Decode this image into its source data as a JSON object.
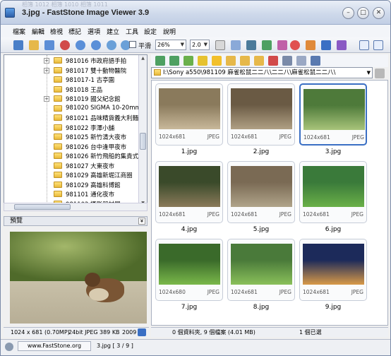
{
  "window": {
    "title": "3.jpg  -  FastStone Image Viewer 3.9",
    "ghost_tabs": "   相簿 1012    相簿 1010    相簿 1011"
  },
  "menu": [
    "檔案",
    "編輯",
    "檢視",
    "標記",
    "選項",
    "建立",
    "工具",
    "設定",
    "說明"
  ],
  "toolbar": {
    "zoom_value": "26%",
    "ratio_value": "2.0",
    "smooth_label": "平滑"
  },
  "tree": {
    "items": [
      {
        "label": "981016 市政府語手拍",
        "expandable": true
      },
      {
        "label": "981017 雙十動物醫院",
        "expandable": true
      },
      {
        "label": "981017-1 古亭園",
        "expandable": false
      },
      {
        "label": "981018 王品",
        "expandable": false
      },
      {
        "label": "981019 國父紀念館",
        "expandable": true
      },
      {
        "label": "981020 SIGMA 10-20mm",
        "expandable": false
      },
      {
        "label": "981021 品味精貨義大利麵",
        "expandable": false
      },
      {
        "label": "981022 李澤小舖",
        "expandable": false
      },
      {
        "label": "981025 新竹清大夜市",
        "expandable": false
      },
      {
        "label": "981026 台中逢甲夜市",
        "expandable": false
      },
      {
        "label": "981026 新竹飛船的集貴式",
        "expandable": false
      },
      {
        "label": "981027 大東夜市",
        "expandable": false
      },
      {
        "label": "981029 高雄新堀江商圈",
        "expandable": false
      },
      {
        "label": "981029 高雄科博館",
        "expandable": false
      },
      {
        "label": "981101 通化夜市",
        "expandable": false
      },
      {
        "label": "981102 攝影器材展",
        "expandable": false
      }
    ]
  },
  "preview": {
    "header": "預覽"
  },
  "status_left": {
    "dims": "1024 x 681 (0.70MP)",
    "fmt": "24bit JPEG",
    "size": "389 KB",
    "year": "2009"
  },
  "address": {
    "path": "I:\\Sony a550\\981109 麻雀松鼠二二八\\二二八\\麻雀松鼠二二八\\"
  },
  "thumbnails": [
    {
      "name": "1.jpg",
      "res": "1024x681",
      "fmt": "JPEG",
      "selected": false
    },
    {
      "name": "2.jpg",
      "res": "1024x681",
      "fmt": "JPEG",
      "selected": false
    },
    {
      "name": "3.jpg",
      "res": "1024x681",
      "fmt": "JPEG",
      "selected": true
    },
    {
      "name": "4.jpg",
      "res": "1024x681",
      "fmt": "JPEG",
      "selected": false
    },
    {
      "name": "5.jpg",
      "res": "1024x681",
      "fmt": "JPEG",
      "selected": false
    },
    {
      "name": "6.jpg",
      "res": "1024x681",
      "fmt": "JPEG",
      "selected": false
    },
    {
      "name": "7.jpg",
      "res": "1024x680",
      "fmt": "JPEG",
      "selected": false
    },
    {
      "name": "8.jpg",
      "res": "1024x681",
      "fmt": "JPEG",
      "selected": false
    },
    {
      "name": "9.jpg",
      "res": "1024x681",
      "fmt": "JPEG",
      "selected": false
    }
  ],
  "status_right": {
    "summary": "0 個資料夾, 9 個檔案 (4.01 MB)",
    "selected": "1 個已選"
  },
  "bottom": {
    "url": "www.FastStone.org",
    "file_info": "3.jpg [ 3 / 9 ]"
  },
  "colors": {
    "selection": "#3a6fc4",
    "folder": "#e8b93a"
  }
}
